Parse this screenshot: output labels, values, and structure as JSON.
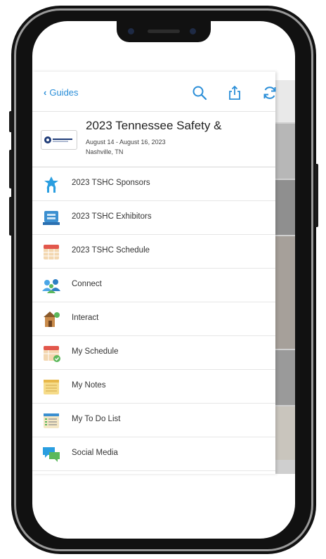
{
  "nav": {
    "back_label": "Guides"
  },
  "toolbar": {
    "search_icon": "search-icon",
    "share_icon": "share-icon",
    "refresh_icon": "refresh-icon",
    "accent": "#2a8ed8"
  },
  "event": {
    "title": "2023 Tennessee Safety &",
    "dates": "August 14 - August 16, 2023",
    "location": "Nashville, TN"
  },
  "menu": [
    {
      "label": "2023 TSHC Sponsors",
      "icon": "sponsors-icon"
    },
    {
      "label": "2023 TSHC Exhibitors",
      "icon": "exhibitors-icon"
    },
    {
      "label": "2023 TSHC Schedule",
      "icon": "schedule-icon"
    },
    {
      "label": "Connect",
      "icon": "connect-icon"
    },
    {
      "label": "Interact",
      "icon": "interact-icon"
    },
    {
      "label": "My Schedule",
      "icon": "my-schedule-icon"
    },
    {
      "label": "My Notes",
      "icon": "notes-icon"
    },
    {
      "label": "My To Do List",
      "icon": "todo-list-icon"
    },
    {
      "label": "Social Media",
      "icon": "social-media-icon"
    }
  ]
}
